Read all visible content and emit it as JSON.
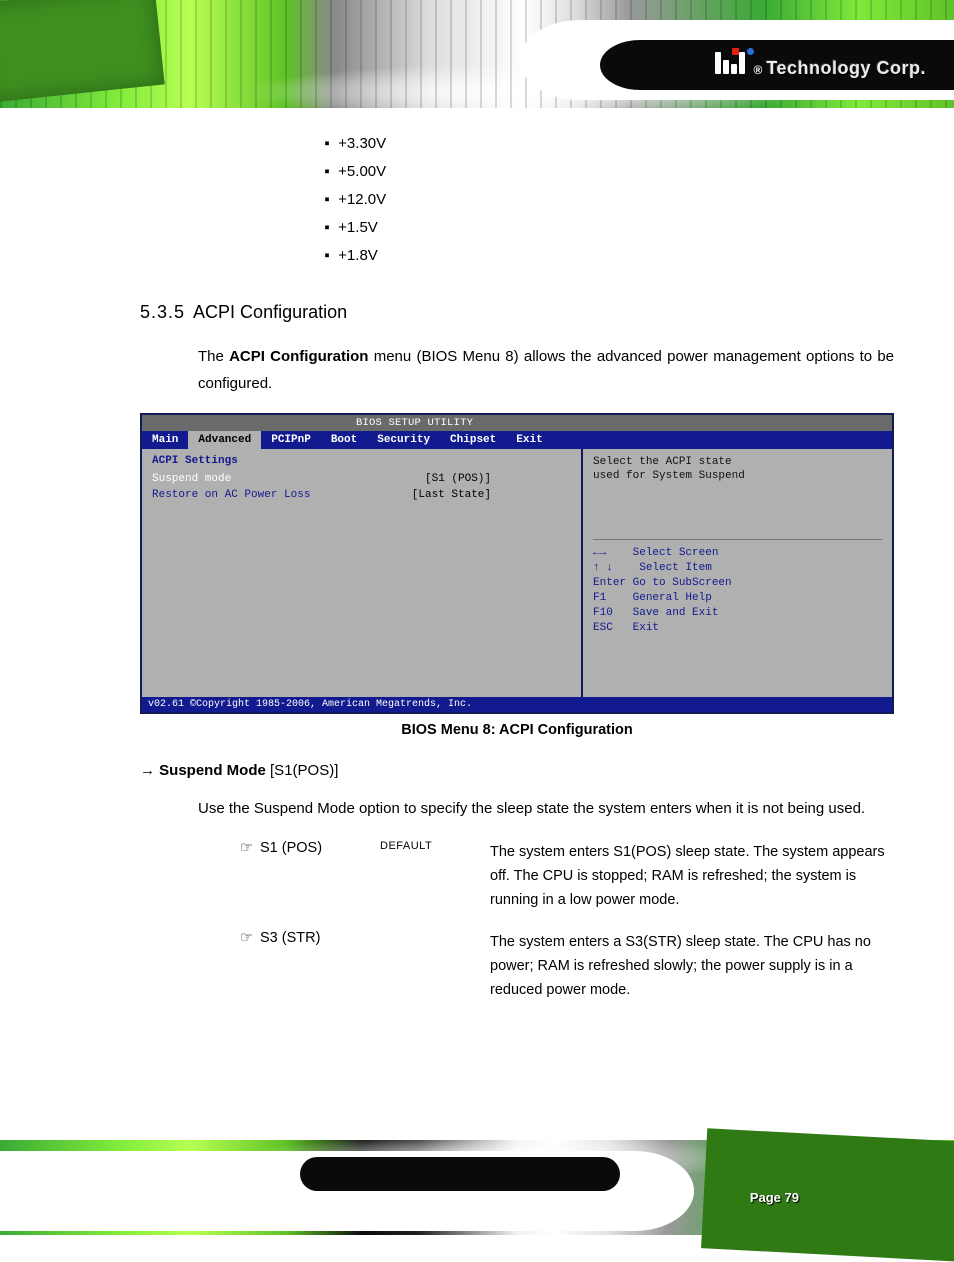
{
  "header": {
    "logo_text": "Technology Corp.",
    "reg": "®"
  },
  "voltages": [
    "+3.30V",
    "+5.00V",
    "+12.0V",
    "+1.5V",
    "+1.8V"
  ],
  "section": {
    "number": "5.3.5 ",
    "title": "ACPI Configuration"
  },
  "intro": {
    "t1": "The ",
    "bold": "ACPI Configuration",
    "t2": " menu (",
    "link": "BIOS Menu 8",
    "t3": ") allows the advanced power management options to be configured."
  },
  "bios": {
    "topbar": "BIOS SETUP UTILITY",
    "tabs": [
      "Main",
      "Advanced",
      "PCIPnP",
      "Boot",
      "Security",
      "Chipset",
      "Exit"
    ],
    "active_tab": 1,
    "left_header": "ACPI Settings",
    "rows": [
      {
        "label": "Suspend mode",
        "value": "[S1 (POS)]",
        "sel": true
      },
      {
        "label": "Restore on AC Power Loss",
        "value": "[Last State]",
        "sel": false
      }
    ],
    "right_desc_1": "Select the ACPI state",
    "right_desc_2": "used for System Suspend",
    "keys": [
      "←→    Select Screen",
      "↑ ↓    Select Item",
      "Enter Go to SubScreen",
      "F1    General Help",
      "F10   Save and Exit",
      "ESC   Exit"
    ],
    "footer_left": "v02.61 ©Copyright 1985-2006, American Megatrends, Inc.",
    "caption": "BIOS Menu 8: ACPI Configuration"
  },
  "field": {
    "arrow": "→  ",
    "name": "Suspend Mode ",
    "bracket": "[S1(POS)]",
    "para_t1": "Use the ",
    "para_bold": "Suspend Mode",
    "para_t2": " option to specify the sleep state the system enters when it is not being used."
  },
  "options": [
    {
      "name": "S1 (POS)",
      "default": "DEFAULT",
      "desc": "The system enters S1(POS) sleep state. The system appears off. The CPU is stopped; RAM is refreshed; the system is running in a low power mode."
    },
    {
      "name": "S3 (STR)",
      "default": "",
      "desc": "The system enters a S3(STR) sleep state. The CPU has no power; RAM is refreshed slowly; the power supply is in a reduced power mode."
    }
  ],
  "page_label": "Page 79"
}
